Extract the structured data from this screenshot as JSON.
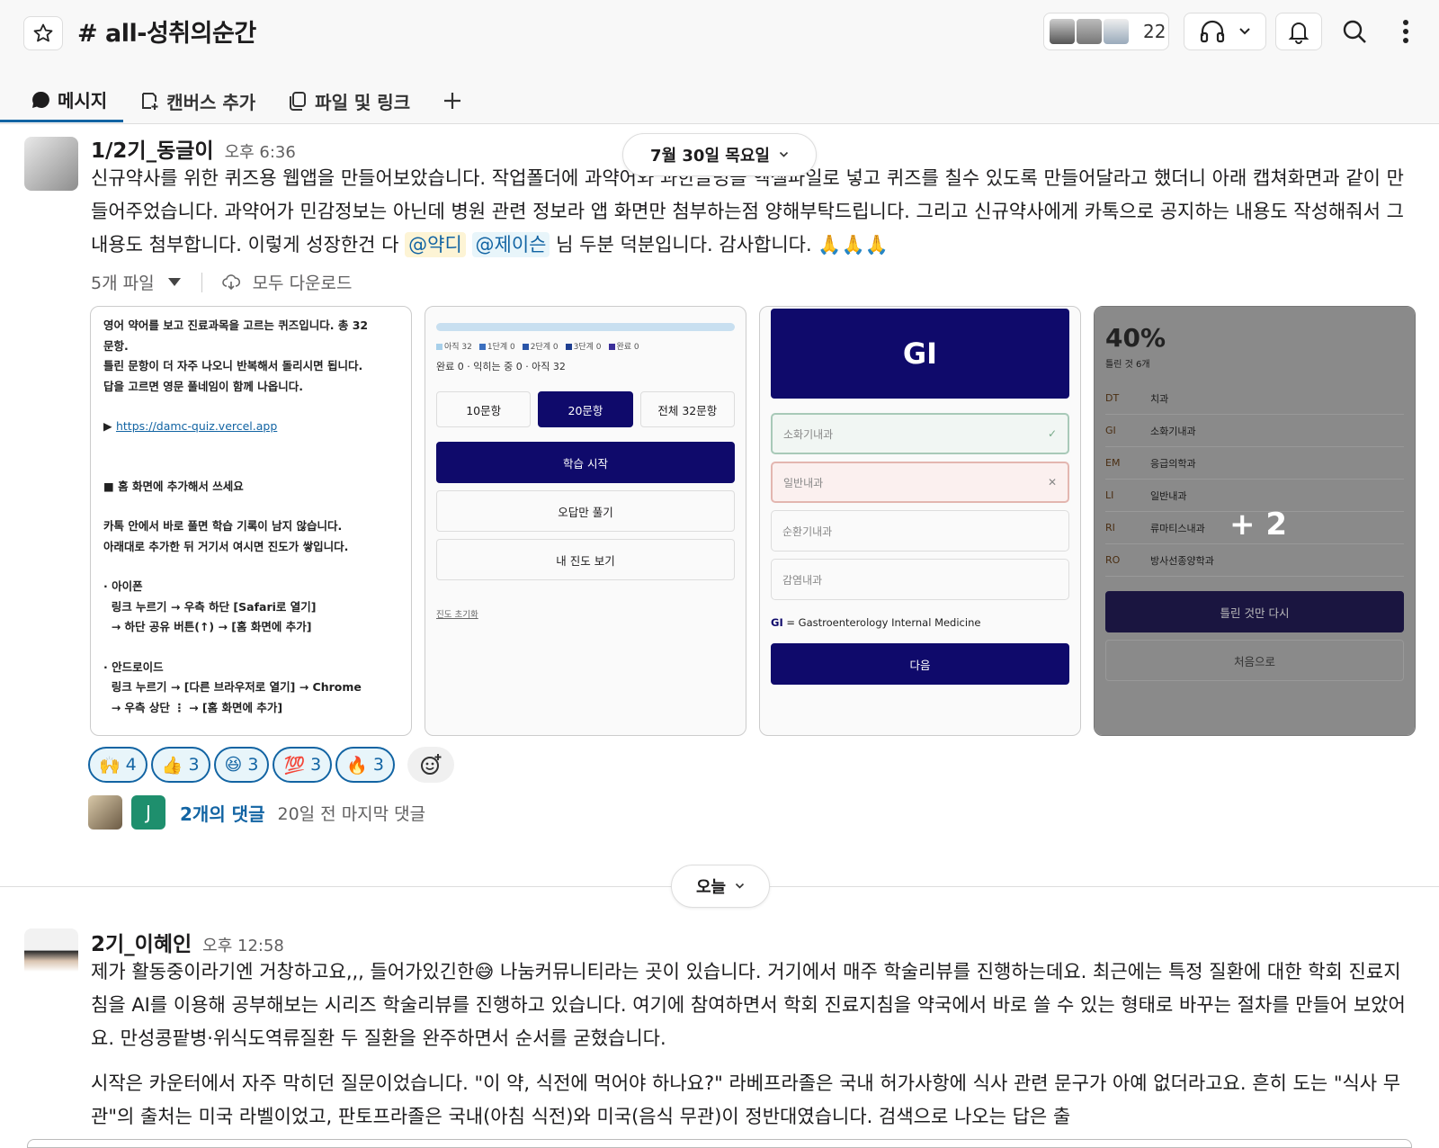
{
  "header": {
    "channel_title": "# all-성취의순간",
    "member_count": "22",
    "tabs": [
      {
        "label": "메시지"
      },
      {
        "label": "캔버스 추가"
      },
      {
        "label": "파일 및 링크"
      }
    ]
  },
  "date_pills": {
    "top": "7월 30일 목요일",
    "today": "오늘"
  },
  "message1": {
    "author": "1/2기_동글이",
    "time": "오후 6:36",
    "text_a": "신규약사를 위한 퀴즈용 웹앱을 만들어보았습니다. 작업폴더에 과약어와 과한글명을 엑셀파일로 넣고 퀴즈를 칠수 있도록 만들어달라고 했더니 아래 캡쳐화면과 같이 만들어주었습니다. 과약어가 민감정보는 아닌데 병원 관련 정보라 앱 화면만 첨부하는점 양해부탁드립니다. 그리고 신규약사에게 카톡으로 공지하는 내용도 작성해줘서 그 내용도 첨부합니다. 이렇게 성장한건 다 ",
    "mention1": "@약디",
    "mention2": "@제이슨",
    "text_b": " 님 두분 덕분입니다. 감사합니다. 🙏🙏🙏",
    "file_count": "5개 파일",
    "download_all": "모두 다운로드",
    "reactions": [
      {
        "emoji": "🙌",
        "count": "4"
      },
      {
        "emoji": "👍",
        "count": "3"
      },
      {
        "emoji": "😆",
        "count": "3"
      },
      {
        "emoji": "💯",
        "count": "3"
      },
      {
        "emoji": "🔥",
        "count": "3"
      }
    ],
    "reply_avatar_letter": "J",
    "reply_count": "2개의 댓글",
    "reply_time": "20일 전 마지막 댓글"
  },
  "thumb1": {
    "l1": "영어 약어를 보고 진료과목을 고르는 퀴즈입니다. 총 32",
    "l2": "문항.",
    "l3": "틀린 문항이 더 자주 나오니 반복해서 돌리시면 됩니다.",
    "l4": "답을 고르면 영문 풀네임이 함께 나옵니다.",
    "link": "https://damc-quiz.vercel.app",
    "l5": "■ 홈 화면에 추가해서 쓰세요",
    "l6": "카톡 안에서 바로 풀면 학습 기록이 남지 않습니다.",
    "l7": "아래대로 추가한 뒤 거기서 여시면 진도가 쌓입니다.",
    "l8": "· 아이폰",
    "l9": "  링크 누르기 → 우측 하단 [Safari로 열기]",
    "l10": "  → 하단 공유 버튼(↑) → [홈 화면에 추가]",
    "l11": "· 안드로이드",
    "l12": "  링크 누르기 → [다른 브라우저로 열기] → Chrome",
    "l13": "  → 우측 상단 ⋮ → [홈 화면에 추가]"
  },
  "thumb2": {
    "legend": [
      "아직 32",
      "1단계 0",
      "2단계 0",
      "3단계 0",
      "완료 0"
    ],
    "status": "완료 0 · 익히는 중 0 · 아직 32",
    "q10": "10문항",
    "q20": "20문항",
    "qall": "전체 32문항",
    "start": "학습 시작",
    "wrong_only": "오답만 풀기",
    "progress": "내 진도 보기",
    "reset": "진도 초기화"
  },
  "thumb3": {
    "abbr": "GI",
    "opt1": "소화기내과",
    "opt2": "일반내과",
    "opt3": "순환기내과",
    "opt4": "감염내과",
    "footer_abbr": "GI",
    "footer_text": " = Gastroenterology Internal Medicine",
    "next": "다음"
  },
  "thumb4": {
    "percent": "40%",
    "wrong_label": "틀린 것 6개",
    "rows": [
      {
        "abbr": "DT",
        "name": "치과"
      },
      {
        "abbr": "GI",
        "name": "소화기내과"
      },
      {
        "abbr": "EM",
        "name": "응급의학과"
      },
      {
        "abbr": "LI",
        "name": "일반내과"
      },
      {
        "abbr": "RI",
        "name": "류마티스내과"
      },
      {
        "abbr": "RO",
        "name": "방사선종양학과"
      }
    ],
    "retry": "틀린 것만 다시",
    "home": "처음으로",
    "more": "+ 2"
  },
  "message2": {
    "author": "2기_이혜인",
    "time": "오후 12:58",
    "p1": "제가 활동중이라기엔 거창하고요,,, 들어가있긴한😅 나눔커뮤니티라는 곳이 있습니다. 거기에서 매주 학술리뷰를 진행하는데요. 최근에는 특정 질환에 대한 학회 진료지침을 AI를 이용해 공부해보는 시리즈 학술리뷰를 진행하고 있습니다. 여기에 참여하면서 학회 진료지침을 약국에서 바로 쓸 수 있는 형태로 바꾸는 절차를 만들어 보았어요. 만성콩팥병·위식도역류질환 두 질환을 완주하면서 순서를 굳혔습니다.",
    "p2": "시작은 카운터에서 자주 막히던 질문이었습니다. \"이 약, 식전에 먹어야 하나요?\" 라베프라졸은 국내 허가사항에 식사 관련 문구가 아예 없더라고요. 흔히 도는 \"식사 무관\"의 출처는 미국 라벨이었고, 판토프라졸은 국내(아침 식전)와 미국(음식 무관)이 정반대였습니다. 검색으로 나오는 답은 출"
  }
}
